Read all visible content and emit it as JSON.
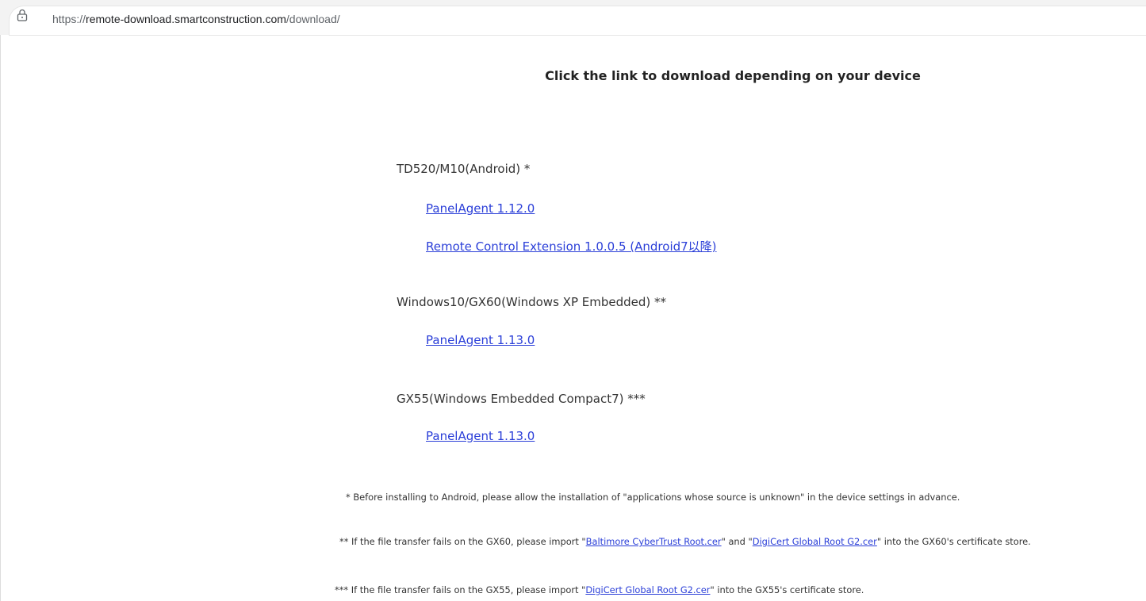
{
  "browser": {
    "url_prefix": "https://",
    "url_host": "remote-download.smartconstruction.com",
    "url_path": "/download/",
    "lock_icon": "lock-icon"
  },
  "page": {
    "heading": "Click the link to download depending on your device",
    "sections": [
      {
        "device": "TD520/M10(Android) *",
        "links": [
          "PanelAgent 1.12.0",
          "Remote Control Extension 1.0.0.5 (Android7以降)"
        ]
      },
      {
        "device": "Windows10/GX60(Windows XP Embedded) **",
        "links": [
          "PanelAgent 1.13.0"
        ]
      },
      {
        "device": "GX55(Windows Embedded Compact7) ***",
        "links": [
          "PanelAgent 1.13.0"
        ]
      }
    ],
    "notes": {
      "note1": "* Before installing to Android, please allow the installation of \"applications whose source is unknown\" in the device settings in advance.",
      "note2_a": "** If the file transfer fails on the GX60, please import \"",
      "note2_link1": "Baltimore CyberTrust Root.cer",
      "note2_b": "\" and \"",
      "note2_link2": "DigiCert Global Root G2.cer",
      "note2_c": "\" into the GX60's certificate store.",
      "note3_a": "*** If the file transfer fails on the GX55, please import \"",
      "note3_link1": "DigiCert Global Root G2.cer",
      "note3_b": "\" into the GX55's certificate store."
    }
  }
}
